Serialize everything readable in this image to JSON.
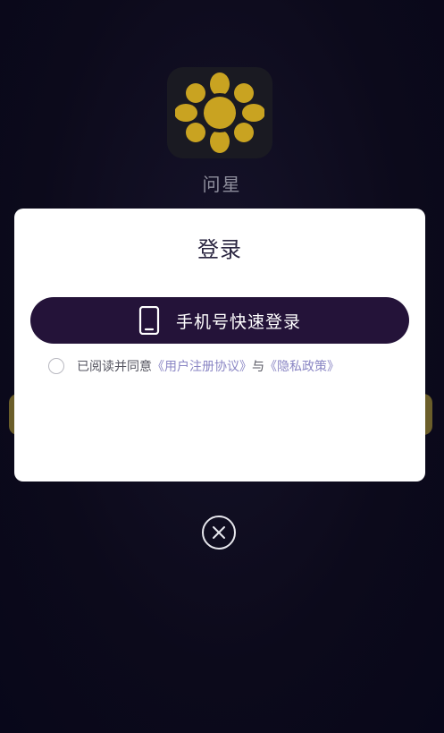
{
  "app": {
    "name": "问星",
    "icon": "sunflower-icon"
  },
  "dialog": {
    "title": "登录",
    "login_button_label": "手机号快速登录",
    "login_button_icon": "smartphone-icon",
    "agreement": {
      "prefix": "已阅读并同意",
      "user_agreement_link": "《用户注册协议》",
      "connector": "与",
      "privacy_policy_link": "《隐私政策》",
      "checked": false
    }
  },
  "close": {
    "icon": "close-icon"
  },
  "colors": {
    "background": "#0c0a1b",
    "button": "#241339",
    "link": "#8a86c4",
    "icon_gold": "#c9a321"
  }
}
